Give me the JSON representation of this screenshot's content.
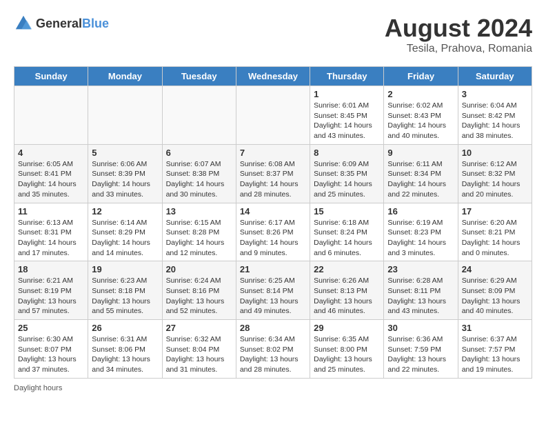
{
  "logo": {
    "text_general": "General",
    "text_blue": "Blue"
  },
  "title": {
    "month_year": "August 2024",
    "location": "Tesila, Prahova, Romania"
  },
  "days_of_week": [
    "Sunday",
    "Monday",
    "Tuesday",
    "Wednesday",
    "Thursday",
    "Friday",
    "Saturday"
  ],
  "footer": {
    "daylight_label": "Daylight hours"
  },
  "weeks": [
    [
      {
        "day": "",
        "empty": true
      },
      {
        "day": "",
        "empty": true
      },
      {
        "day": "",
        "empty": true
      },
      {
        "day": "",
        "empty": true
      },
      {
        "day": "1",
        "sunrise": "Sunrise: 6:01 AM",
        "sunset": "Sunset: 8:45 PM",
        "daylight": "Daylight: 14 hours and 43 minutes."
      },
      {
        "day": "2",
        "sunrise": "Sunrise: 6:02 AM",
        "sunset": "Sunset: 8:43 PM",
        "daylight": "Daylight: 14 hours and 40 minutes."
      },
      {
        "day": "3",
        "sunrise": "Sunrise: 6:04 AM",
        "sunset": "Sunset: 8:42 PM",
        "daylight": "Daylight: 14 hours and 38 minutes."
      }
    ],
    [
      {
        "day": "4",
        "sunrise": "Sunrise: 6:05 AM",
        "sunset": "Sunset: 8:41 PM",
        "daylight": "Daylight: 14 hours and 35 minutes."
      },
      {
        "day": "5",
        "sunrise": "Sunrise: 6:06 AM",
        "sunset": "Sunset: 8:39 PM",
        "daylight": "Daylight: 14 hours and 33 minutes."
      },
      {
        "day": "6",
        "sunrise": "Sunrise: 6:07 AM",
        "sunset": "Sunset: 8:38 PM",
        "daylight": "Daylight: 14 hours and 30 minutes."
      },
      {
        "day": "7",
        "sunrise": "Sunrise: 6:08 AM",
        "sunset": "Sunset: 8:37 PM",
        "daylight": "Daylight: 14 hours and 28 minutes."
      },
      {
        "day": "8",
        "sunrise": "Sunrise: 6:09 AM",
        "sunset": "Sunset: 8:35 PM",
        "daylight": "Daylight: 14 hours and 25 minutes."
      },
      {
        "day": "9",
        "sunrise": "Sunrise: 6:11 AM",
        "sunset": "Sunset: 8:34 PM",
        "daylight": "Daylight: 14 hours and 22 minutes."
      },
      {
        "day": "10",
        "sunrise": "Sunrise: 6:12 AM",
        "sunset": "Sunset: 8:32 PM",
        "daylight": "Daylight: 14 hours and 20 minutes."
      }
    ],
    [
      {
        "day": "11",
        "sunrise": "Sunrise: 6:13 AM",
        "sunset": "Sunset: 8:31 PM",
        "daylight": "Daylight: 14 hours and 17 minutes."
      },
      {
        "day": "12",
        "sunrise": "Sunrise: 6:14 AM",
        "sunset": "Sunset: 8:29 PM",
        "daylight": "Daylight: 14 hours and 14 minutes."
      },
      {
        "day": "13",
        "sunrise": "Sunrise: 6:15 AM",
        "sunset": "Sunset: 8:28 PM",
        "daylight": "Daylight: 14 hours and 12 minutes."
      },
      {
        "day": "14",
        "sunrise": "Sunrise: 6:17 AM",
        "sunset": "Sunset: 8:26 PM",
        "daylight": "Daylight: 14 hours and 9 minutes."
      },
      {
        "day": "15",
        "sunrise": "Sunrise: 6:18 AM",
        "sunset": "Sunset: 8:24 PM",
        "daylight": "Daylight: 14 hours and 6 minutes."
      },
      {
        "day": "16",
        "sunrise": "Sunrise: 6:19 AM",
        "sunset": "Sunset: 8:23 PM",
        "daylight": "Daylight: 14 hours and 3 minutes."
      },
      {
        "day": "17",
        "sunrise": "Sunrise: 6:20 AM",
        "sunset": "Sunset: 8:21 PM",
        "daylight": "Daylight: 14 hours and 0 minutes."
      }
    ],
    [
      {
        "day": "18",
        "sunrise": "Sunrise: 6:21 AM",
        "sunset": "Sunset: 8:19 PM",
        "daylight": "Daylight: 13 hours and 57 minutes."
      },
      {
        "day": "19",
        "sunrise": "Sunrise: 6:23 AM",
        "sunset": "Sunset: 8:18 PM",
        "daylight": "Daylight: 13 hours and 55 minutes."
      },
      {
        "day": "20",
        "sunrise": "Sunrise: 6:24 AM",
        "sunset": "Sunset: 8:16 PM",
        "daylight": "Daylight: 13 hours and 52 minutes."
      },
      {
        "day": "21",
        "sunrise": "Sunrise: 6:25 AM",
        "sunset": "Sunset: 8:14 PM",
        "daylight": "Daylight: 13 hours and 49 minutes."
      },
      {
        "day": "22",
        "sunrise": "Sunrise: 6:26 AM",
        "sunset": "Sunset: 8:13 PM",
        "daylight": "Daylight: 13 hours and 46 minutes."
      },
      {
        "day": "23",
        "sunrise": "Sunrise: 6:28 AM",
        "sunset": "Sunset: 8:11 PM",
        "daylight": "Daylight: 13 hours and 43 minutes."
      },
      {
        "day": "24",
        "sunrise": "Sunrise: 6:29 AM",
        "sunset": "Sunset: 8:09 PM",
        "daylight": "Daylight: 13 hours and 40 minutes."
      }
    ],
    [
      {
        "day": "25",
        "sunrise": "Sunrise: 6:30 AM",
        "sunset": "Sunset: 8:07 PM",
        "daylight": "Daylight: 13 hours and 37 minutes."
      },
      {
        "day": "26",
        "sunrise": "Sunrise: 6:31 AM",
        "sunset": "Sunset: 8:06 PM",
        "daylight": "Daylight: 13 hours and 34 minutes."
      },
      {
        "day": "27",
        "sunrise": "Sunrise: 6:32 AM",
        "sunset": "Sunset: 8:04 PM",
        "daylight": "Daylight: 13 hours and 31 minutes."
      },
      {
        "day": "28",
        "sunrise": "Sunrise: 6:34 AM",
        "sunset": "Sunset: 8:02 PM",
        "daylight": "Daylight: 13 hours and 28 minutes."
      },
      {
        "day": "29",
        "sunrise": "Sunrise: 6:35 AM",
        "sunset": "Sunset: 8:00 PM",
        "daylight": "Daylight: 13 hours and 25 minutes."
      },
      {
        "day": "30",
        "sunrise": "Sunrise: 6:36 AM",
        "sunset": "Sunset: 7:59 PM",
        "daylight": "Daylight: 13 hours and 22 minutes."
      },
      {
        "day": "31",
        "sunrise": "Sunrise: 6:37 AM",
        "sunset": "Sunset: 7:57 PM",
        "daylight": "Daylight: 13 hours and 19 minutes."
      }
    ]
  ]
}
